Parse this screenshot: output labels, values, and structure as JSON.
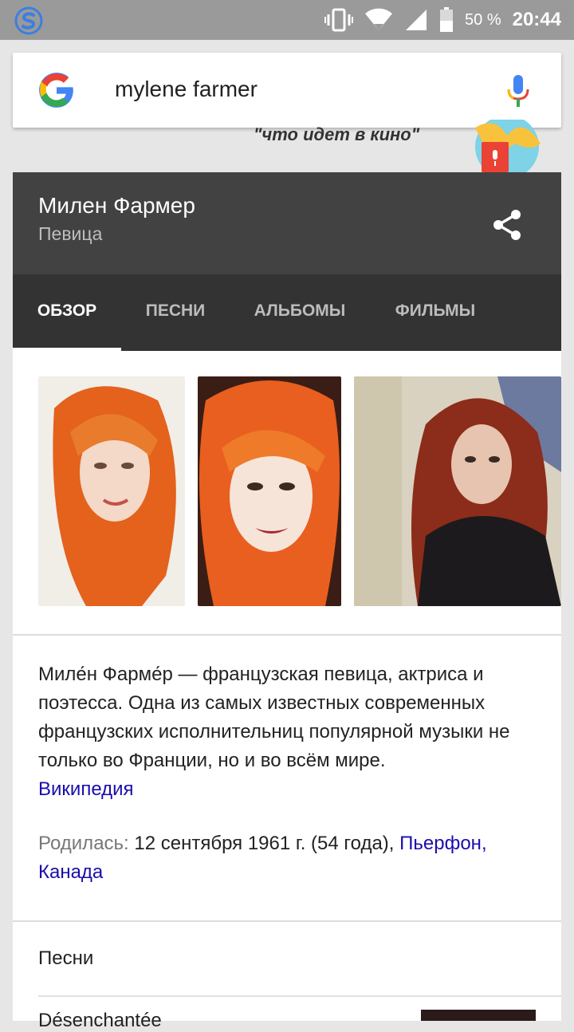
{
  "status_bar": {
    "battery_percent": "50 %",
    "time": "20:44",
    "icons": [
      "swiftkey-s-icon",
      "vibrate-icon",
      "wifi-icon",
      "signal-icon",
      "battery-icon"
    ]
  },
  "search": {
    "query": "mylene farmer",
    "icons": [
      "google-g-icon",
      "mic-icon"
    ]
  },
  "doodle": {
    "caption": "\"что идет в кино\""
  },
  "knowledge_panel": {
    "title": "Милен Фармер",
    "subtitle": "Певица",
    "tabs": [
      {
        "label": "ОБЗОР",
        "active": true
      },
      {
        "label": "ПЕСНИ",
        "active": false
      },
      {
        "label": "АЛЬБОМЫ",
        "active": false
      },
      {
        "label": "ФИЛЬМЫ",
        "active": false
      }
    ],
    "description": "Миле́н Фарме́р — французская певица, актриса и поэтесса. Одна из самых известных современных французских исполнительниц популярной музыки не только во Франции, но и во всём мире.",
    "source_link": "Википедия",
    "born_label": "Родилась:",
    "born_value": "12 сентября 1961 г. (54 года),",
    "born_place": "Пьерфон, Канада",
    "songs_heading": "Песни",
    "first_song": "Désenchantée"
  },
  "colors": {
    "status_bar": "#9a9a9a",
    "panel_header": "#424242",
    "tabs_bg": "#333333",
    "link": "#1a0dab"
  }
}
